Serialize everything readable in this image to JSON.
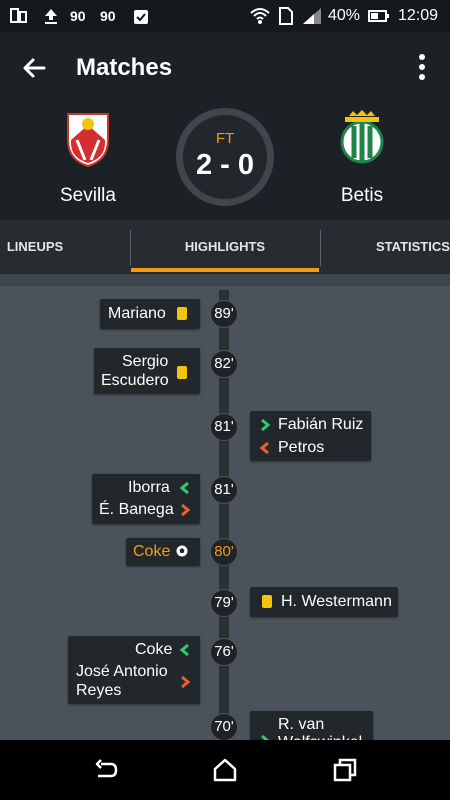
{
  "status_bar": {
    "battery": "40%",
    "time": "12:09"
  },
  "app_bar": {
    "title": "Matches"
  },
  "match": {
    "status": "FT",
    "score": "2 - 0",
    "home_team": "Sevilla",
    "away_team": "Betis"
  },
  "tabs": [
    {
      "label": "LINEUPS"
    },
    {
      "label": "HIGHLIGHTS"
    },
    {
      "label": "STATISTICS"
    }
  ],
  "events": [
    {
      "minute": "89'",
      "side": "home",
      "type": "yellow-card",
      "player": "Mariano"
    },
    {
      "minute": "82'",
      "side": "home",
      "type": "yellow-card",
      "player_line1": "Sergio",
      "player_line2": "Escudero"
    },
    {
      "minute": "81'",
      "side": "away",
      "type": "substitution",
      "player_in": "Fabián Ruiz",
      "player_out": "Petros"
    },
    {
      "minute": "81'",
      "side": "home",
      "type": "substitution",
      "player_in": "Iborra",
      "player_out": "É. Banega"
    },
    {
      "minute": "80'",
      "side": "home",
      "type": "goal",
      "player": "Coke"
    },
    {
      "minute": "79'",
      "side": "away",
      "type": "yellow-card",
      "player": "H. Westermann"
    },
    {
      "minute": "76'",
      "side": "home",
      "type": "substitution",
      "player_in": "Coke",
      "player_out_line1": "José Antonio",
      "player_out_line2": "Reyes"
    },
    {
      "minute": "70'",
      "side": "away",
      "type": "substitution",
      "player_in": "R. van",
      "player_in_partial": "Wolfswinkel"
    }
  ],
  "colors": {
    "accent": "#f39c12",
    "sub_in": "#2ecc71",
    "sub_out": "#e8622a",
    "yellow_card": "#f1c40f"
  }
}
